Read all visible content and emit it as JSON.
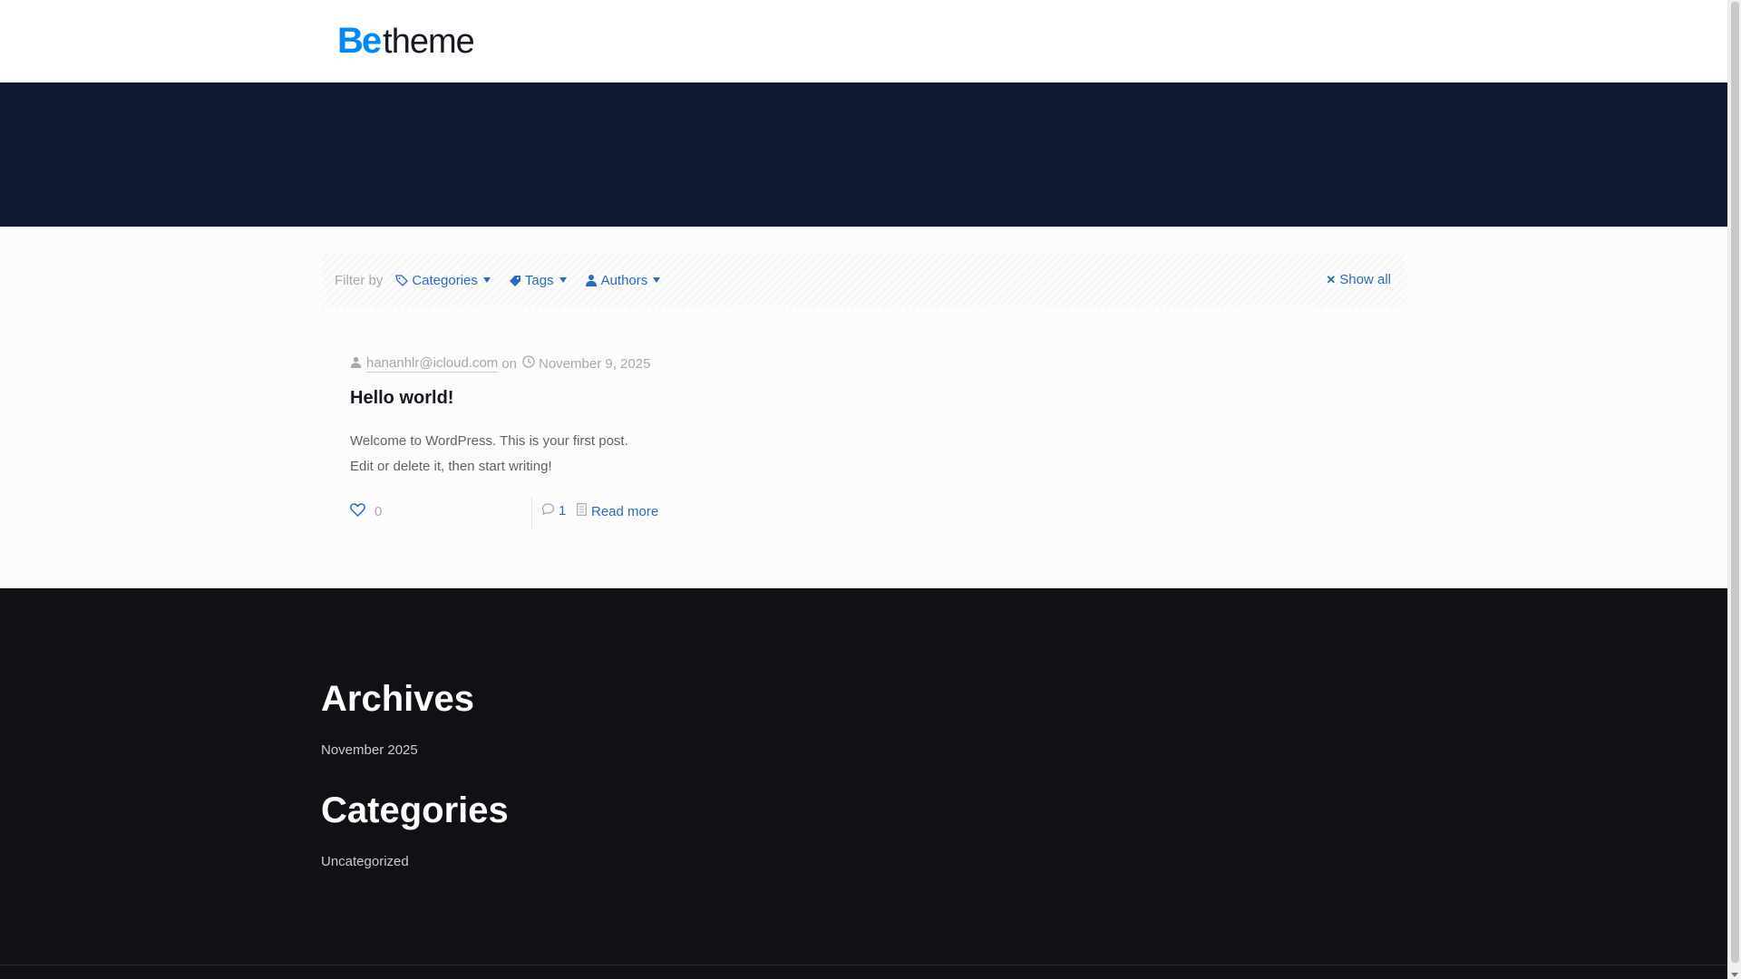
{
  "header": {
    "logo_be": "Be",
    "logo_theme": "theme"
  },
  "filters": {
    "label": "Filter by",
    "categories": "Categories",
    "tags": "Tags",
    "authors": "Authors",
    "show_all": "Show all"
  },
  "post": {
    "author": "hananhlr@icloud.com",
    "on": "on",
    "date": "November 9, 2025",
    "title": "Hello world!",
    "excerpt_line1": "Welcome to WordPress. This is your first post.",
    "excerpt_line2": "Edit or delete it, then start writing!",
    "likes": "0",
    "comments": "1",
    "read_more": "Read more"
  },
  "footer": {
    "archives_title": "Archives",
    "archives_item": "November 2025",
    "categories_title": "Categories",
    "categories_item": "Uncategorized"
  },
  "colors": {
    "brand_blue": "#0089f7",
    "link_blue": "#2a6bbf",
    "subheader_navy": "#101730",
    "footer_dark": "#101015"
  }
}
